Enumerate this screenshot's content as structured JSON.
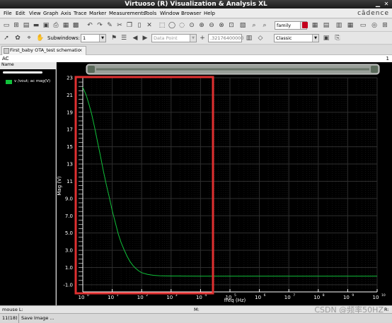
{
  "window": {
    "title": "Virtuoso (R) Visualization & Analysis XL"
  },
  "menu": [
    "File",
    "Edit",
    "View",
    "Graph",
    "Axis",
    "Trace",
    "Marker",
    "Measurements",
    "Tools",
    "Window",
    "Browser",
    "Help"
  ],
  "brand": "cādence",
  "toolbar1": {
    "family_field": "family"
  },
  "toolbar2": {
    "subwindows_label": "Subwindows:",
    "subwindows_value": "1",
    "data_point_placeholder": "Data Point",
    "coordinate_value": ".32176400000",
    "style_value": "Classic"
  },
  "tab": {
    "label": "First_baby OTA_test schematic",
    "close": "×"
  },
  "window_name": "AC",
  "subwindow_index": "1",
  "legend": {
    "header": "Name",
    "items": [
      {
        "label": "v /vout; ac mag(V)",
        "color": "#10c23a"
      }
    ]
  },
  "colors": {
    "trace": "#10c23a",
    "highlight_box": "#e03030",
    "plot_bg": "#000000"
  },
  "chart_data": {
    "type": "line",
    "x_scale": "log",
    "xlabel": "freq (Hz)",
    "ylabel": "Mag (V)",
    "xlim": [
      1,
      10000000000
    ],
    "ylim": [
      -1.5,
      23
    ],
    "x_ticks": [
      {
        "base": "10",
        "exp": "0"
      },
      {
        "base": "10",
        "exp": "1"
      },
      {
        "base": "10",
        "exp": "2"
      },
      {
        "base": "10",
        "exp": "3"
      },
      {
        "base": "10",
        "exp": "4"
      },
      {
        "base": "10",
        "exp": "5"
      },
      {
        "base": "10",
        "exp": "6"
      },
      {
        "base": "10",
        "exp": "7"
      },
      {
        "base": "10",
        "exp": "8"
      },
      {
        "base": "10",
        "exp": "9"
      },
      {
        "base": "10",
        "exp": "10"
      }
    ],
    "x_tick_values": [
      1,
      10,
      100,
      1000,
      10000,
      100000,
      1000000,
      10000000,
      100000000,
      1000000000,
      10000000000
    ],
    "y_ticks": [
      "23",
      "21",
      "19",
      "17",
      "15",
      "13",
      "11",
      "9.0",
      "7.0",
      "5.0",
      "3.0",
      "1.0",
      "-1.0"
    ],
    "y_tick_values": [
      23,
      21,
      19,
      17,
      15,
      13,
      11,
      9,
      7,
      5,
      3,
      1,
      -1
    ],
    "grid": true,
    "series": [
      {
        "name": "v /vout; ac mag(V)",
        "x": [
          1,
          1.3,
          1.6,
          2,
          2.5,
          3.2,
          4,
          5,
          6.3,
          8,
          10,
          13,
          16,
          20,
          25,
          32,
          40,
          50,
          63,
          80,
          100,
          160,
          250,
          400,
          630,
          1000,
          2500,
          10000,
          100000,
          1000000,
          10000000,
          100000000,
          1000000000,
          10000000000
        ],
        "y": [
          21.9,
          21.0,
          20.0,
          18.8,
          17.3,
          15.5,
          13.9,
          12.2,
          10.6,
          9.1,
          7.6,
          6.1,
          4.9,
          3.9,
          3.1,
          2.3,
          1.7,
          1.25,
          0.9,
          0.6,
          0.4,
          0.2,
          0.1,
          0.05,
          0.03,
          0.02,
          0.01,
          0.0,
          0.0,
          0.0,
          0.0,
          0.0,
          0.0,
          0.0
        ]
      }
    ]
  },
  "status": {
    "mouse_label": "mouse L:",
    "mouse_mid": "M:",
    "mouse_right": "R:",
    "counter": "11(18)",
    "message": "Save Image ..."
  },
  "watermark": "CSDN @频率50HZ"
}
